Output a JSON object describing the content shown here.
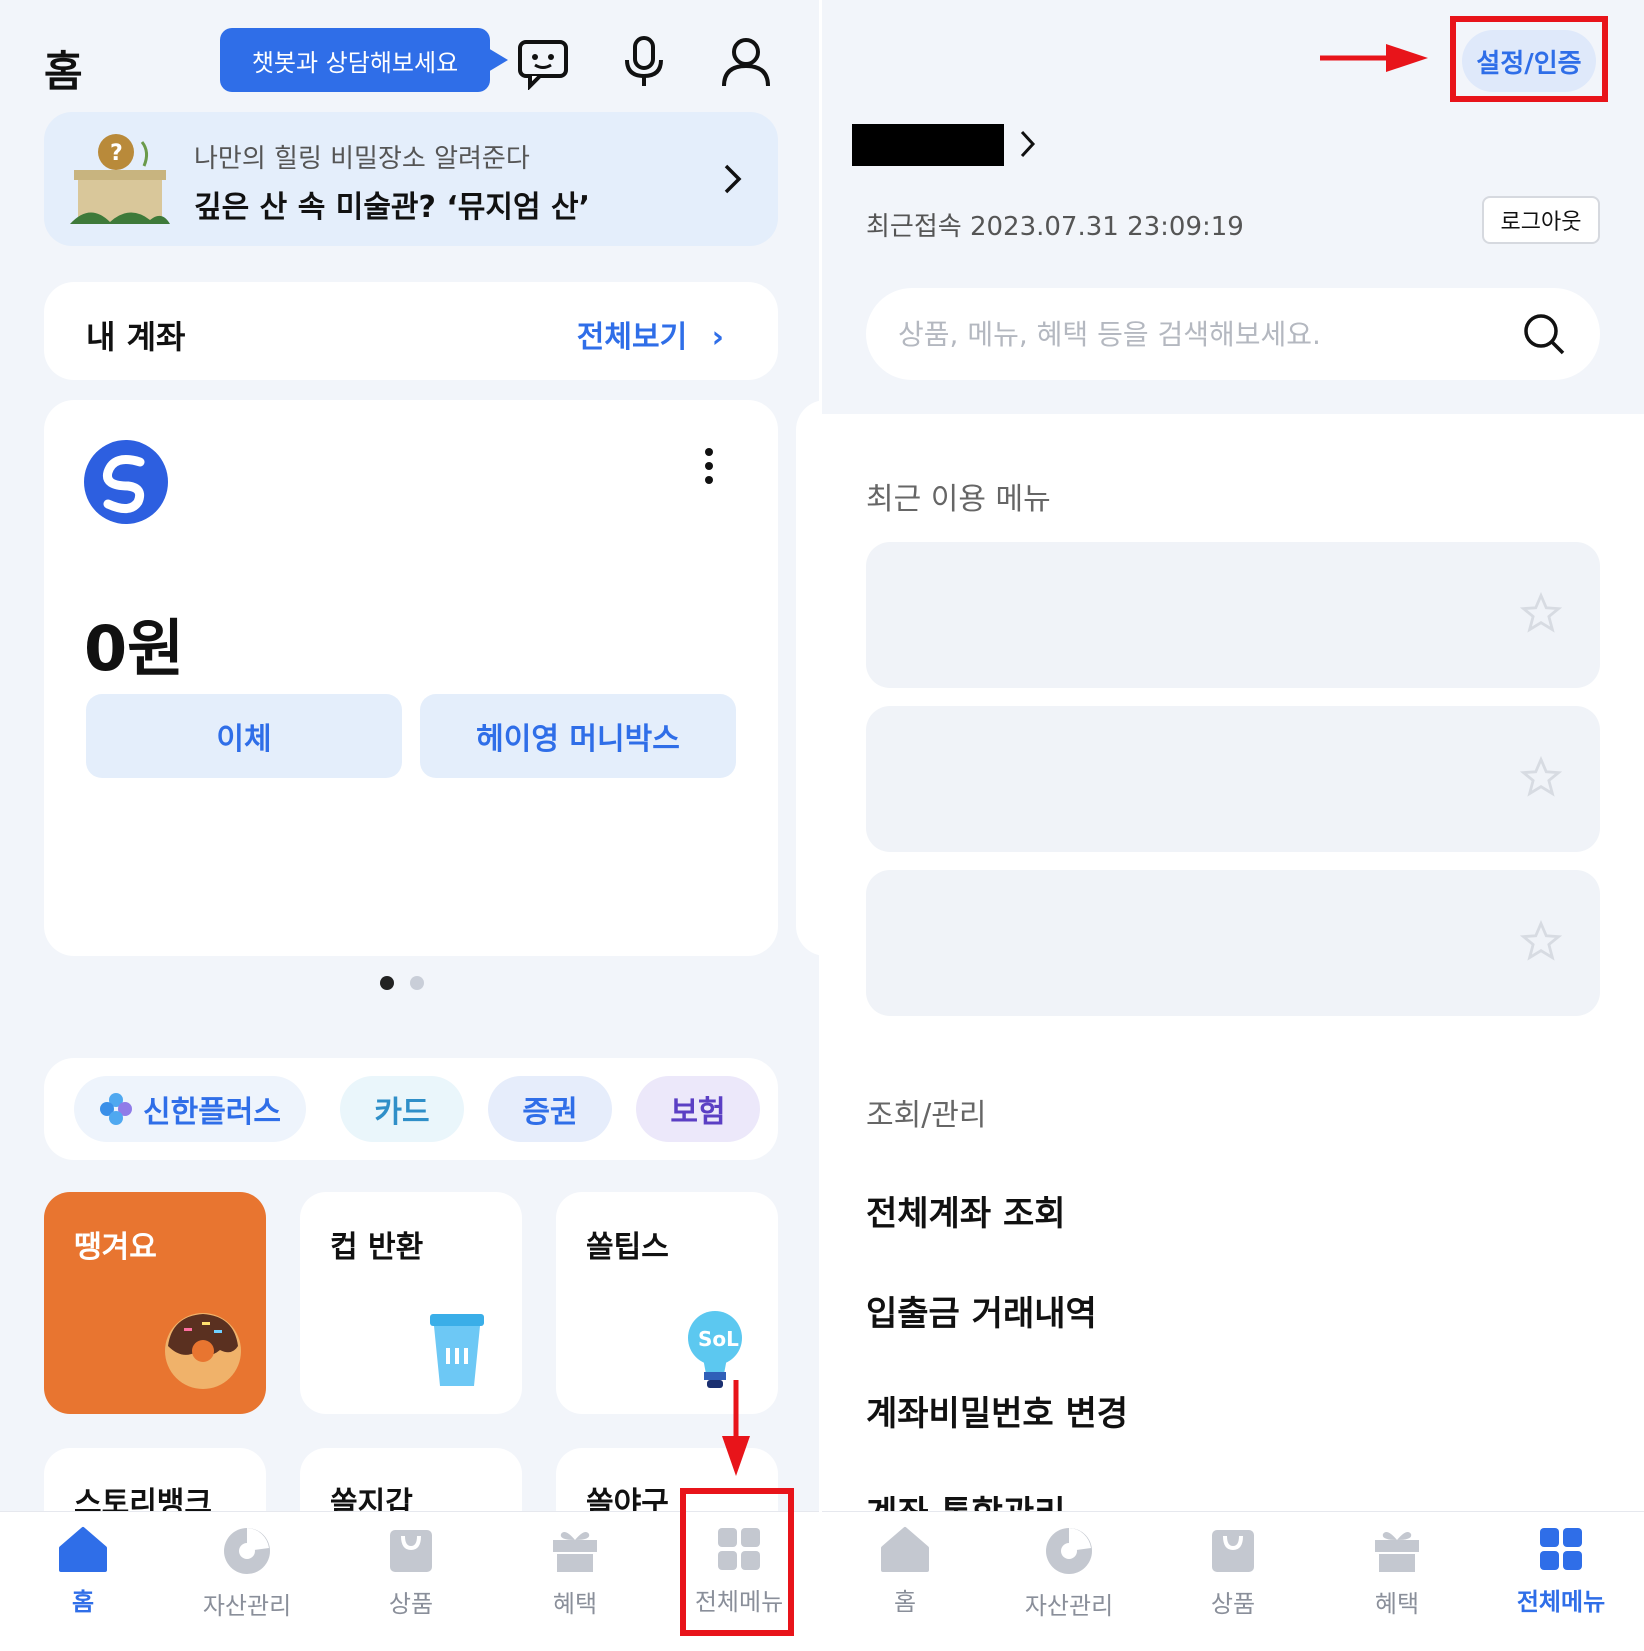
{
  "left": {
    "header": {
      "title": "홈",
      "chat_bubble": "챗봇과 상담해보세요",
      "icons": [
        "chatbot-icon",
        "microphone-icon",
        "profile-icon"
      ]
    },
    "banner": {
      "subtitle": "나만의 힐링 비밀장소 알려준다",
      "title": "깊은 산 속 미술관? ‘뮤지엄 산’"
    },
    "my_account": {
      "title": "내 계좌",
      "view_all": "전체보기"
    },
    "account_card": {
      "balance": "0원",
      "buttons": [
        "이체",
        "헤이영 머니박스"
      ]
    },
    "pager": {
      "count": 2,
      "active": 0
    },
    "chips": [
      "신한플러스",
      "카드",
      "증권",
      "보험"
    ],
    "tiles": [
      "땡겨요",
      "컵 반환",
      "쏠팁스"
    ],
    "tiles_row2": [
      "스토리뱅크",
      "쏠지갑",
      "쏠야구"
    ],
    "tabbar": [
      "홈",
      "자산관리",
      "상품",
      "혜택",
      "전체메뉴"
    ],
    "active_tab": "홈"
  },
  "right": {
    "settings_button": "설정/인증",
    "last_login": "최근접속 2023.07.31 23:09:19",
    "logout": "로그아웃",
    "search_placeholder": "상품, 메뉴, 혜택 등을 검색해보세요.",
    "recent_menu_label": "최근 이용 메뉴",
    "inquiry_label": "조회/관리",
    "menu_items": [
      "전체계좌 조회",
      "입출금 거래내역",
      "계좌비밀번호 변경",
      "계좌 통합관리"
    ],
    "tabbar": [
      "홈",
      "자산관리",
      "상품",
      "혜택",
      "전체메뉴"
    ],
    "active_tab": "전체메뉴"
  },
  "colors": {
    "accent": "#2f6ee8",
    "highlight": "#e8141a",
    "tile_orange": "#e87530",
    "chip_purple": "#5b3fc4"
  }
}
